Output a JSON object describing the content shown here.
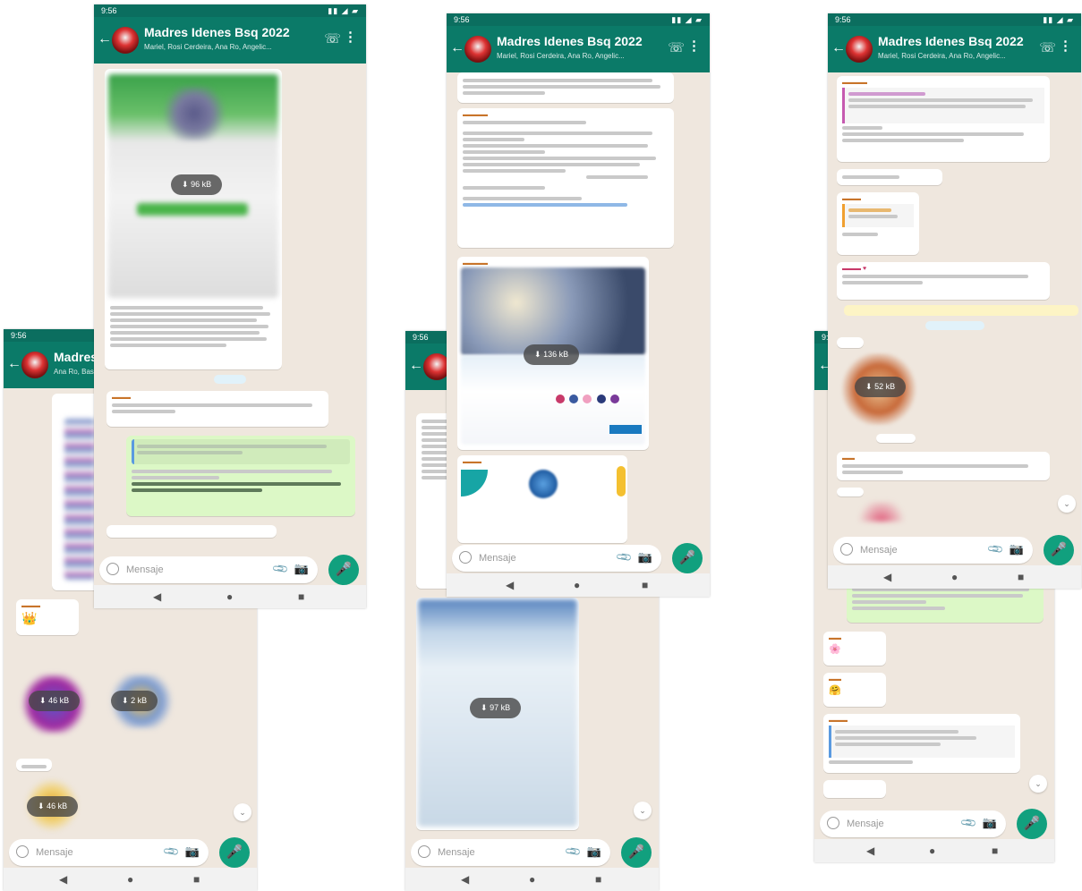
{
  "chat": {
    "title": "Madres Idenes Bsq 2022",
    "subtitle_left": "Ana Ro, Bas...",
    "subtitle": "Mariel, Rosi Cerdeira, Ana Ro, Angelic...",
    "input_placeholder": "Mensaje",
    "time_status": "9:56"
  },
  "icons": {
    "back": "←",
    "call": "☏",
    "menu": "⋮",
    "mic": "🎤",
    "clip": "📎",
    "camera": "📷",
    "nav_back": "◀",
    "nav_home": "●",
    "nav_recent": "■",
    "download": "⬇",
    "scroll": "⌄"
  },
  "downloads": {
    "p1_a": "46 kB",
    "p1_b": "2 kB",
    "p1_c": "46 kB",
    "p2_main": "97 kB",
    "p3_main": "96 kB",
    "p3_poster": "136 kB",
    "p4_sticker": "52 kB"
  },
  "accent": {
    "header": "#0b7a68",
    "mic": "#11a07e",
    "outgoing": "#dcf8c6",
    "background": "#efe7de"
  }
}
